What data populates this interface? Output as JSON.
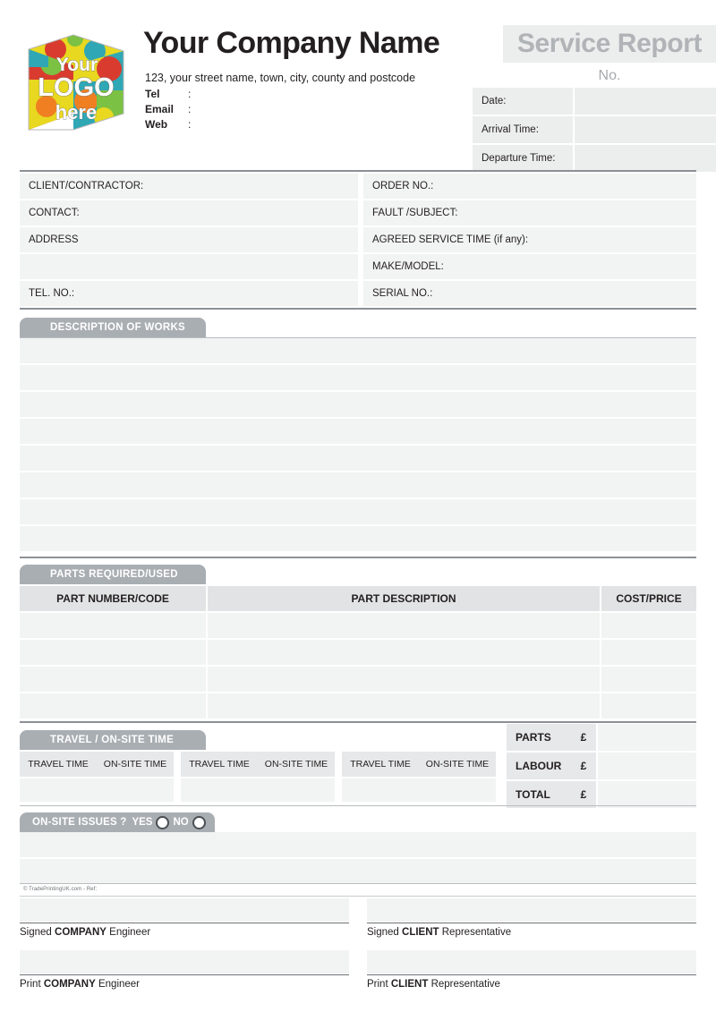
{
  "header": {
    "logo": {
      "line1": "Your",
      "line2": "LOGO",
      "line3": "here",
      "icon": "puzzle-cube-logo"
    },
    "company_name": "Your Company Name",
    "address": "123, your street name, town, city, county and postcode",
    "contact": [
      {
        "label": "Tel",
        "sep": ":",
        "value": ""
      },
      {
        "label": "Email",
        "sep": ":",
        "value": ""
      },
      {
        "label": "Web",
        "sep": ":",
        "value": ""
      }
    ],
    "report_title": "Service Report",
    "report_no_label": "No.",
    "meta_rows": [
      {
        "label": "Date:",
        "value": ""
      },
      {
        "label": "Arrival Time:",
        "value": ""
      },
      {
        "label": "Departure Time:",
        "value": ""
      }
    ]
  },
  "client": {
    "left": [
      {
        "label": "CLIENT/CONTRACTOR:",
        "value": ""
      },
      {
        "label": "CONTACT:",
        "value": ""
      },
      {
        "label": "ADDRESS",
        "value": ""
      },
      {
        "label": "",
        "value": ""
      },
      {
        "label": "TEL. NO.:",
        "value": ""
      }
    ],
    "right": [
      {
        "label": "ORDER NO.:",
        "value": ""
      },
      {
        "label": "FAULT /SUBJECT:",
        "value": ""
      },
      {
        "label": "AGREED SERVICE TIME (if any):",
        "value": ""
      },
      {
        "label": "MAKE/MODEL:",
        "value": ""
      },
      {
        "label": "SERIAL NO.:",
        "value": ""
      }
    ]
  },
  "description": {
    "tab_label": "DESCRIPTION OF WORKS",
    "rows": [
      "",
      "",
      "",
      "",
      "",
      "",
      "",
      ""
    ]
  },
  "parts": {
    "tab_label": "PARTS REQUIRED/USED",
    "columns": [
      "PART NUMBER/CODE",
      "PART DESCRIPTION",
      "COST/PRICE"
    ],
    "rows": [
      [
        "",
        "",
        ""
      ],
      [
        "",
        "",
        ""
      ],
      [
        "",
        "",
        ""
      ],
      [
        "",
        "",
        ""
      ]
    ]
  },
  "time": {
    "tab_label": "TRAVEL / ON-SITE TIME",
    "headers": [
      "TRAVEL TIME",
      "ON-SITE TIME",
      "TRAVEL TIME",
      "ON-SITE TIME",
      "TRAVEL TIME",
      "ON-SITE TIME"
    ],
    "values": [
      "",
      "",
      "",
      "",
      "",
      ""
    ]
  },
  "totals": {
    "currency": "£",
    "rows": [
      {
        "label": "PARTS",
        "currency": "£",
        "value": ""
      },
      {
        "label": "LABOUR",
        "currency": "£",
        "value": ""
      },
      {
        "label": "TOTAL",
        "currency": "£",
        "value": ""
      }
    ]
  },
  "issues": {
    "question": "ON-SITE ISSUES ?",
    "yes_label": "YES",
    "no_label": "NO",
    "rows": [
      "",
      ""
    ]
  },
  "footer": {
    "copyright": "© TradePrintingUK.com - Ref:",
    "signatures": [
      {
        "prefix": "Signed ",
        "strong": "COMPANY",
        "suffix": " Engineer",
        "value": ""
      },
      {
        "prefix": "Signed ",
        "strong": "CLIENT",
        "suffix": " Representative",
        "value": ""
      },
      {
        "prefix": "Print ",
        "strong": "COMPANY",
        "suffix": " Engineer",
        "value": ""
      },
      {
        "prefix": "Print ",
        "strong": "CLIENT",
        "suffix": " Representative",
        "value": ""
      }
    ]
  },
  "colors": {
    "tab_gray": "#a9aeb3",
    "field_fill": "#f2f3f3",
    "header_fill": "#e2e3e4",
    "title_gray": "#b0b4b7",
    "rule": "#8b9096",
    "text": "#231f20"
  }
}
